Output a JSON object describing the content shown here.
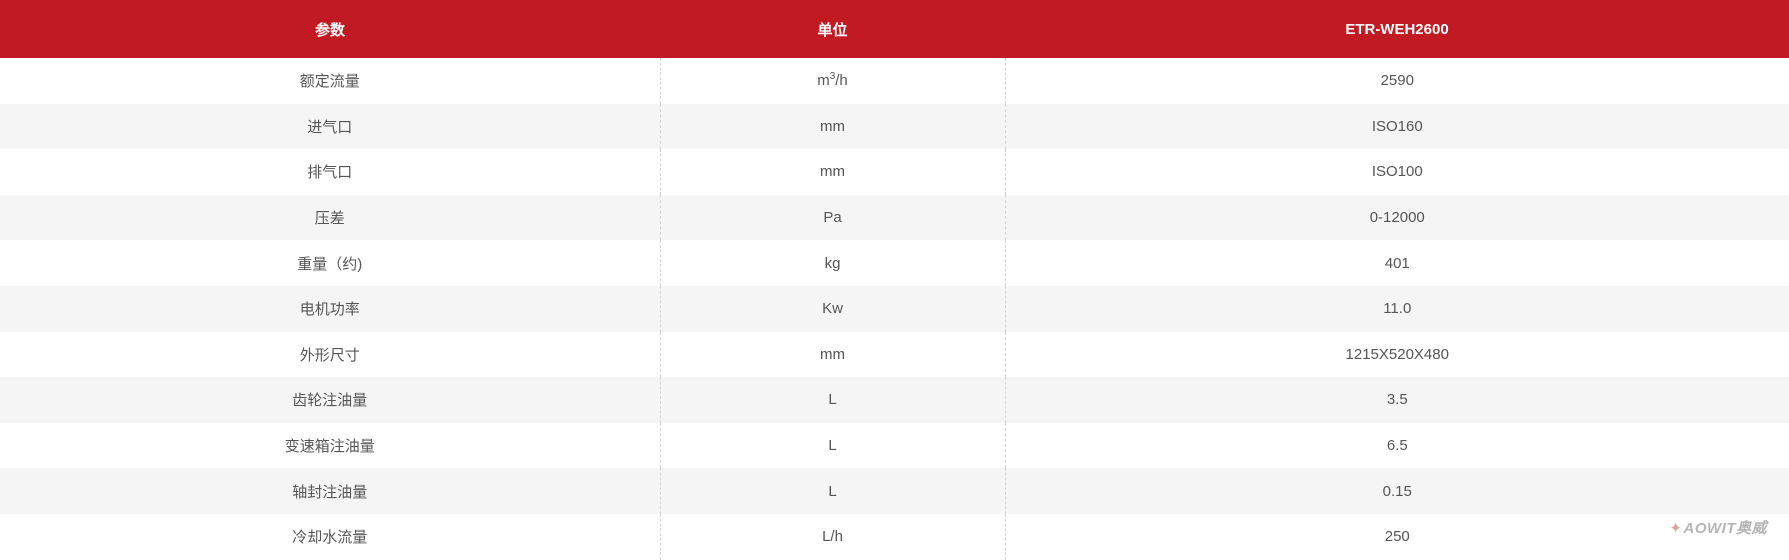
{
  "table": {
    "headers": [
      "参数",
      "单位",
      "ETR-WEH2600"
    ],
    "rows": [
      {
        "param": "额定流量",
        "unit": "m",
        "unit_sup": "3",
        "unit_suffix": "/h",
        "value": "2590"
      },
      {
        "param": "进气口",
        "unit": "mm",
        "value": "ISO160"
      },
      {
        "param": "排气口",
        "unit": "mm",
        "value": "ISO100"
      },
      {
        "param": "压差",
        "unit": "Pa",
        "value": "0-12000"
      },
      {
        "param": "重量（约)",
        "unit": "kg",
        "value": "401"
      },
      {
        "param": "电机功率",
        "unit": "Kw",
        "value": "11.0"
      },
      {
        "param": "外形尺寸",
        "unit": "mm",
        "value": "1215X520X480"
      },
      {
        "param": "齿轮注油量",
        "unit": "L",
        "value": "3.5"
      },
      {
        "param": "变速箱注油量",
        "unit": "L",
        "value": "6.5"
      },
      {
        "param": "轴封注油量",
        "unit": "L",
        "value": "0.15"
      },
      {
        "param": "冷却水流量",
        "unit": "L/h",
        "value": "250"
      }
    ]
  },
  "watermark": {
    "text": "AOWIT奥威"
  },
  "colors": {
    "header_bg": "#c21a22",
    "header_text": "#ffffff",
    "stripe": "#f5f5f5",
    "text": "#555555"
  }
}
